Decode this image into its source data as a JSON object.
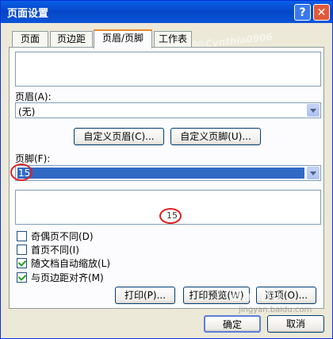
{
  "window": {
    "title": "页面设置",
    "help_glyph": "?",
    "close_glyph": "✕"
  },
  "tabs": [
    {
      "label": "页面"
    },
    {
      "label": "页边距"
    },
    {
      "label": "页眉/页脚"
    },
    {
      "label": "工作表"
    }
  ],
  "header": {
    "label": "页眉(A):",
    "value": "(无)"
  },
  "buttons": {
    "custom_header": "自定义页眉(C)...",
    "custom_footer": "自定义页脚(U)...",
    "print": "打印(P)...",
    "print_preview": "打印预览(W)",
    "options": "选项(O)...",
    "ok": "确定",
    "cancel": "取消"
  },
  "footer": {
    "label": "页脚(F):",
    "value": "15",
    "preview_text": "15"
  },
  "options": [
    {
      "label": "奇偶页不同(D)",
      "checked": false
    },
    {
      "label": "首页不同(I)",
      "checked": false
    },
    {
      "label": "随文档自动缩放(L)",
      "checked": true
    },
    {
      "label": "与页边距对齐(M)",
      "checked": true
    }
  ],
  "watermark": {
    "text": "百度经验@Cynthia0906",
    "baidu": "Bai du",
    "site": "jingyan.baidu.com"
  },
  "colors": {
    "title_bar": "#0546c8",
    "selection": "#316ac5",
    "annotation": "#e02020"
  }
}
